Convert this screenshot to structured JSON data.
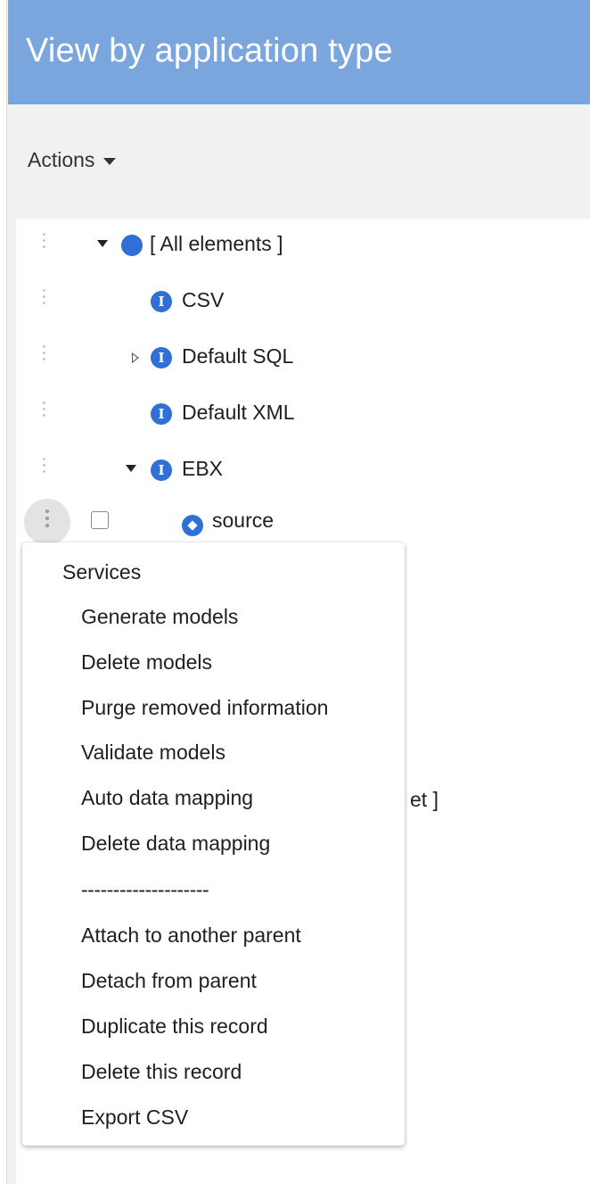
{
  "header": {
    "title": "View by application type"
  },
  "toolbar": {
    "actions_label": "Actions"
  },
  "tree": {
    "nodes": [
      {
        "label": "[ All elements ]",
        "icon": "filled-circle-icon",
        "expanded": true
      },
      {
        "label": "CSV",
        "icon": "info-icon"
      },
      {
        "label": "Default SQL",
        "icon": "info-icon",
        "expanded": false
      },
      {
        "label": "Default XML",
        "icon": "info-icon"
      },
      {
        "label": "EBX",
        "icon": "info-icon",
        "expanded": true
      },
      {
        "label": "source",
        "icon": "diamond-icon",
        "checked": false
      }
    ],
    "partial_label": "et ]"
  },
  "context_menu": {
    "header": "Services",
    "items": [
      "Generate models",
      "Delete models",
      "Purge removed information",
      "Validate models",
      "Auto data mapping",
      "Delete data mapping"
    ],
    "separator": "--------------------",
    "items2": [
      "Attach to another parent",
      "Detach from parent",
      "Duplicate this record",
      "Delete this record",
      "Export CSV"
    ]
  },
  "colors": {
    "header_bg": "#7aa6dd",
    "icon_blue": "#2f6fd6"
  }
}
